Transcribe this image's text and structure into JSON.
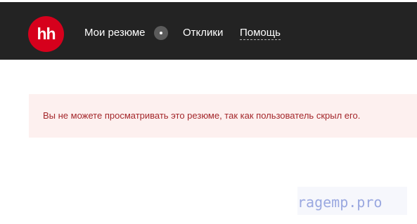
{
  "header": {
    "logo_text": "hh",
    "brand_color": "#d6001c",
    "nav": {
      "my_resumes": "Мои резюме",
      "responses": "Отклики",
      "help": "Помощь"
    },
    "background_color": "#232323"
  },
  "notice": {
    "text": "Вы не можете просматривать это резюме, так как пользователь скрыл его.",
    "text_color": "#a4272b",
    "background_color": "#fdf0ef"
  },
  "watermark": {
    "text": "ragemp.pro"
  }
}
